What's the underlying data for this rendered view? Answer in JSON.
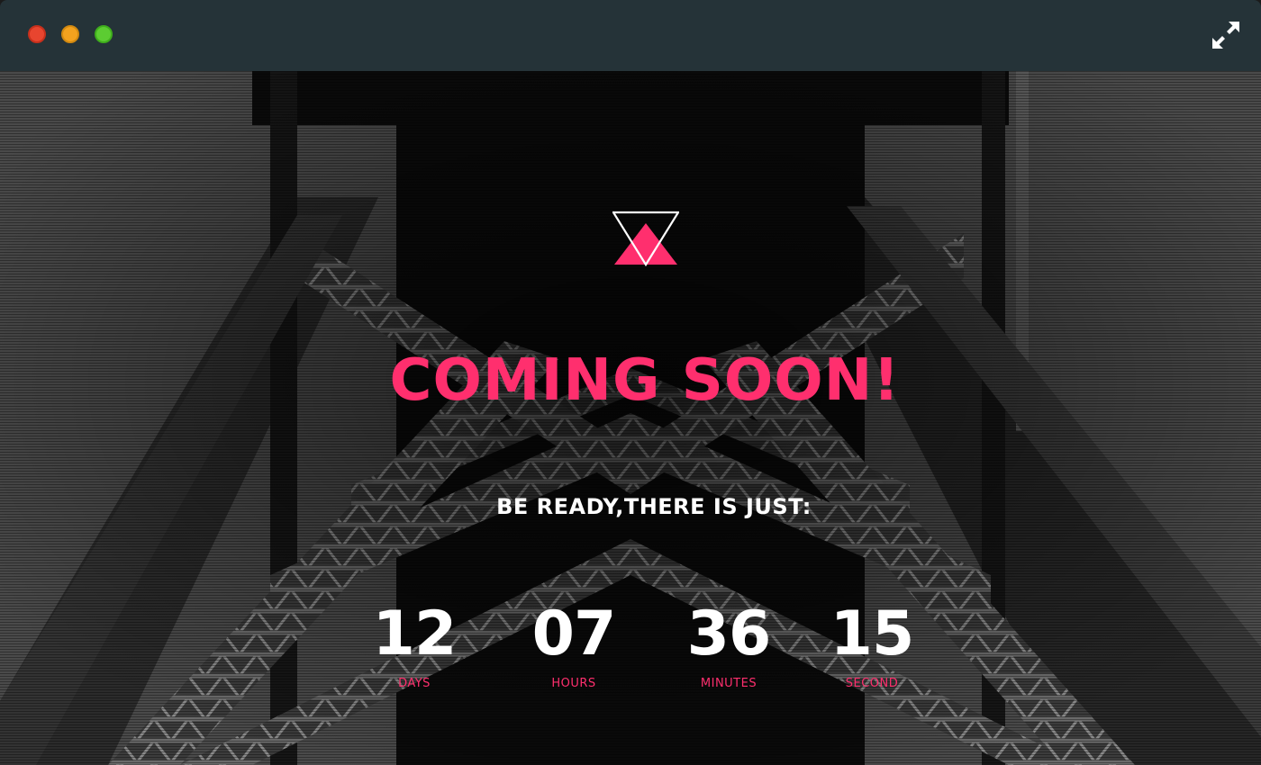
{
  "window": {
    "close_icon": "red-dot",
    "minimize_icon": "yellow-dot",
    "zoom_icon": "green-dot",
    "expand_icon": "expand-arrows-icon",
    "titlebar_color": "#253338"
  },
  "page": {
    "logo_icon": "double-triangle-logo",
    "headline": "COMING SOON!",
    "subline": "BE READY,THERE IS JUST:",
    "accent_color": "#ff2f6e"
  },
  "countdown": [
    {
      "value": "12",
      "label": "DAYS"
    },
    {
      "value": "07",
      "label": "HOURS"
    },
    {
      "value": "36",
      "label": "MINUTES"
    },
    {
      "value": "15",
      "label": "SECOND"
    }
  ]
}
